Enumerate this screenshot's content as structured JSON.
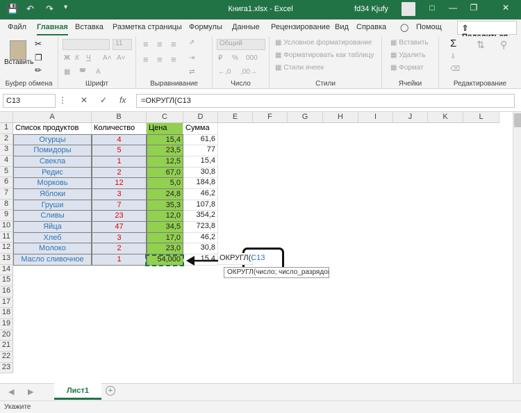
{
  "window": {
    "title": "Книга1.xlsx  -  Excel",
    "user": "fd34 Kjufy",
    "min_icon": "minimize-icon",
    "restore_icon": "restore-icon",
    "close_icon": "close-icon"
  },
  "tabs": [
    "Файл",
    "Главная",
    "Вставка",
    "Разметка страницы",
    "Формулы",
    "Данные",
    "Рецензирование",
    "Вид",
    "Справка"
  ],
  "tell_me": "Помощ",
  "share_label": "Поделиться",
  "ribbon": {
    "paste_label": "Вставить",
    "groups": [
      "Буфер обмена",
      "Шрифт",
      "Выравнивание",
      "Число",
      "Стили",
      "Ячейки",
      "Редактирование"
    ],
    "number_format": "Общий",
    "font_size": "11",
    "styles": [
      "Условное форматирование",
      "Форматировать как таблицу",
      "Стили ячеек"
    ],
    "cells": [
      "Вставить",
      "Удалить",
      "Формат"
    ]
  },
  "formula_bar": {
    "name_box": "C13",
    "formula": "=ОКРУГЛ(C13"
  },
  "columns": [
    "A",
    "B",
    "C",
    "D",
    "E",
    "F",
    "G",
    "H",
    "I",
    "J",
    "K",
    "L"
  ],
  "rows": [
    "1",
    "2",
    "3",
    "4",
    "5",
    "6",
    "7",
    "8",
    "9",
    "10",
    "11",
    "12",
    "13",
    "14",
    "15",
    "16",
    "17",
    "18",
    "19",
    "20",
    "21",
    "22",
    "23"
  ],
  "headers": {
    "a": "Список продуктов",
    "b": "Количество",
    "c": "Цена",
    "d": "Сумма"
  },
  "table": [
    {
      "a": "Огурцы",
      "b": "4",
      "c": "15,4",
      "d": "61,6"
    },
    {
      "a": "Помидоры",
      "b": "5",
      "c": "23,5",
      "d": "77"
    },
    {
      "a": "Свекла",
      "b": "1",
      "c": "12,5",
      "d": "15,4"
    },
    {
      "a": "Редис",
      "b": "2",
      "c": "67,0",
      "d": "30,8"
    },
    {
      "a": "Морковь",
      "b": "12",
      "c": "5,0",
      "d": "184,8"
    },
    {
      "a": "Яблоки",
      "b": "3",
      "c": "24,8",
      "d": "46,2"
    },
    {
      "a": "Груши",
      "b": "7",
      "c": "35,3",
      "d": "107,8"
    },
    {
      "a": "Сливы",
      "b": "23",
      "c": "12,0",
      "d": "354,2"
    },
    {
      "a": "Яйца",
      "b": "47",
      "c": "34,5",
      "d": "723,8"
    },
    {
      "a": "Хлеб",
      "b": "3",
      "c": "17,0",
      "d": "46,2"
    },
    {
      "a": "Молоко",
      "b": "2",
      "c": "23,0",
      "d": "30,8"
    },
    {
      "a": "Масло сливочное",
      "b": "1",
      "c": "54,000",
      "d": "15,4"
    }
  ],
  "editing_cell": {
    "prefix": "ОКРУГЛ(",
    "ref": "C13"
  },
  "tooltip": "ОКРУГЛ(число; число_разрядов)",
  "sheet_tab": "Лист1",
  "status": "Укажите",
  "colors": {
    "accent": "#217346",
    "green_cell": "#92d050",
    "blue_cell": "#dde3ee"
  }
}
